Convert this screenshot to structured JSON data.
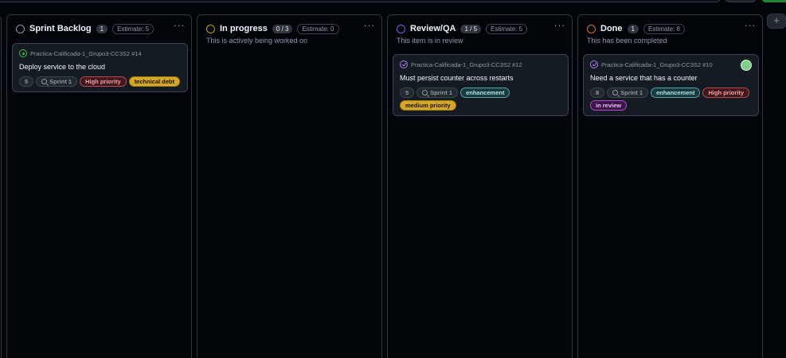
{
  "columns": [
    {
      "title": "Sprint Backlog",
      "count": "1",
      "estimate": "Estimate: 5",
      "description": "",
      "status_color": "#9198a1",
      "cards": [
        {
          "ref": "Practica-Calificada-1_Grupo3-CC3S2 #14",
          "state": "open",
          "title": "Deploy service to the cloud",
          "tags": [
            {
              "label": "5",
              "style": "neutral"
            },
            {
              "label": "Sprint 1",
              "style": "sprint"
            },
            {
              "label": "High priority",
              "style": "red"
            },
            {
              "label": "technical debt",
              "style": "yellow-solid"
            }
          ],
          "avatar": false
        }
      ]
    },
    {
      "title": "In progress",
      "count": "0 / 3",
      "estimate": "Estimate: 0",
      "description": "This is actively being worked on",
      "status_color": "#d29922",
      "cards": []
    },
    {
      "title": "Review/QA",
      "count": "1 / 5",
      "estimate": "Estimate: 5",
      "description": "This item is in review",
      "status_color": "#8957e5",
      "cards": [
        {
          "ref": "Practica-Calificada-1_Grupo3-CC3S2 #12",
          "state": "done",
          "title": "Must persist counter across restarts",
          "tags": [
            {
              "label": "5",
              "style": "neutral"
            },
            {
              "label": "Sprint 1",
              "style": "sprint"
            },
            {
              "label": "enhancement",
              "style": "teal"
            },
            {
              "label": "medium priority",
              "style": "yellow-solid"
            }
          ],
          "avatar": false
        }
      ]
    },
    {
      "title": "Done",
      "count": "1",
      "estimate": "Estimate: 8",
      "description": "This has been completed",
      "status_color": "#db6d28",
      "cards": [
        {
          "ref": "Practica-Calificada-1_Grupo3-CC3S2 #10",
          "state": "done",
          "title": "Need a service that has a counter",
          "tags": [
            {
              "label": "8",
              "style": "neutral"
            },
            {
              "label": "Sprint 1",
              "style": "sprint"
            },
            {
              "label": "enhancement",
              "style": "teal"
            },
            {
              "label": "High priority",
              "style": "red"
            },
            {
              "label": "in review",
              "style": "purple"
            }
          ],
          "avatar": true
        }
      ]
    }
  ],
  "add_column_label": "+",
  "column_menu_label": "···",
  "tag_styles": {
    "red": {
      "color": "#ff9b9b",
      "border": "#c2474d",
      "background": "#3d1a1f"
    },
    "yellow-solid": {
      "color": "#1c1300",
      "border": "#a07d06",
      "background": "#d4a72c"
    },
    "teal": {
      "color": "#a8e6ea",
      "border": "#4aa4aa",
      "background": "#1c3a3d"
    },
    "purple": {
      "color": "#f0b8ff",
      "border": "#b04ad8",
      "background": "#3a1646"
    }
  }
}
